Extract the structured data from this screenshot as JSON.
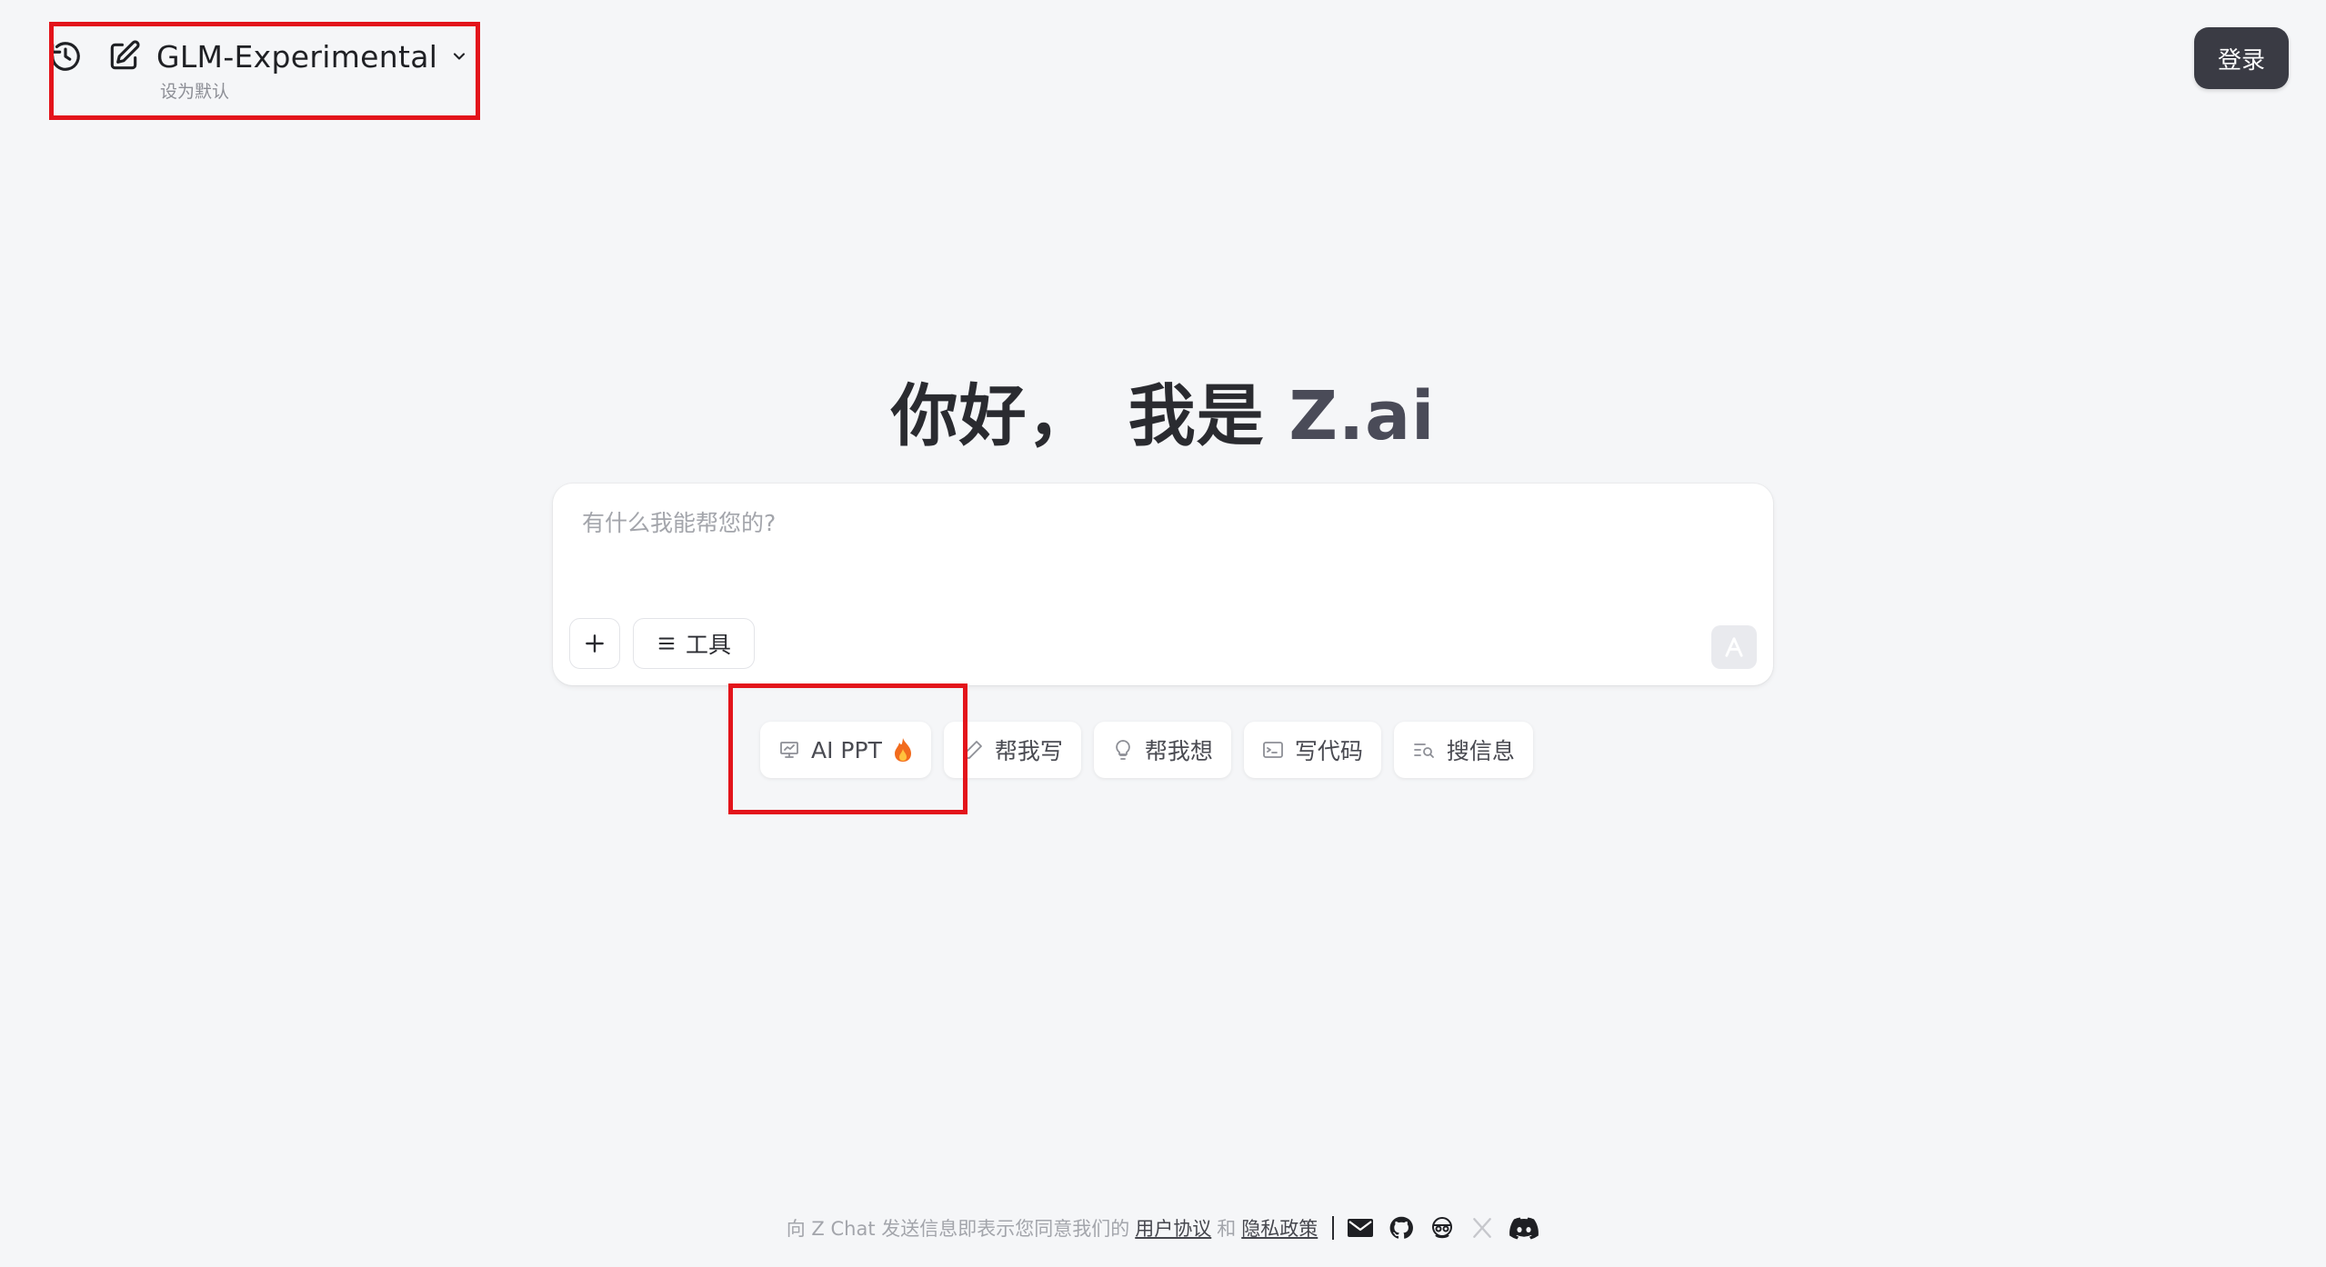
{
  "header": {
    "model_name": "GLM-Experimental",
    "set_default": "设为默认",
    "login_label": "登录",
    "icons": [
      "history-icon",
      "new-chat-icon",
      "chevron-down-icon"
    ]
  },
  "greeting": {
    "hello": "你好，",
    "iam": "我是",
    "brand": "Z.ai"
  },
  "chat": {
    "placeholder": "有什么我能帮您的?",
    "value": "",
    "tools_label": "工具",
    "icons": [
      "plus-icon",
      "menu-lines-icon",
      "send-icon"
    ]
  },
  "suggestions": [
    {
      "label": "AI PPT",
      "icon": "presentation-icon",
      "badge": "fire-emoji"
    },
    {
      "label": "帮我写",
      "icon": "pencil-icon"
    },
    {
      "label": "帮我想",
      "icon": "lightbulb-icon"
    },
    {
      "label": "写代码",
      "icon": "terminal-icon"
    },
    {
      "label": "搜信息",
      "icon": "search-list-icon"
    }
  ],
  "footer": {
    "prefix": "向 Z Chat 发送信息即表示您同意我们的",
    "terms": "用户协议",
    "and": "和",
    "privacy": "隐私政策",
    "social_icons": [
      "mail-icon",
      "github-icon",
      "community-icon",
      "x-icon",
      "discord-icon"
    ]
  },
  "colors": {
    "background": "#f5f6f8",
    "login_button": "#3a3b44",
    "highlight_box": "#e3141b",
    "brand_text": "#4a4b58"
  }
}
